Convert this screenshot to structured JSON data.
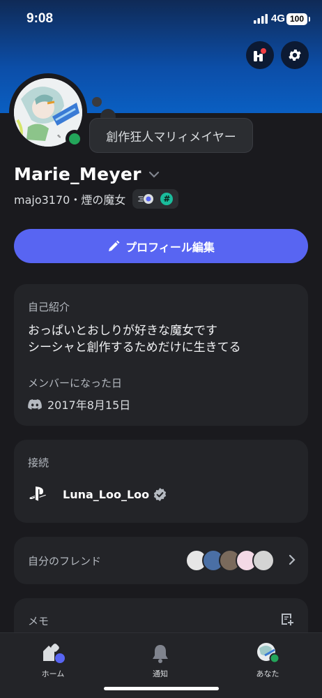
{
  "status_bar": {
    "time": "9:08",
    "network": "4G",
    "battery": "100"
  },
  "profile": {
    "custom_status": "創作狂人マリィメイヤー",
    "display_name": "Marie_Meyer",
    "handle": "majo3170",
    "separator": "・",
    "pronouns": "煙の魔女",
    "badge_hash": "#"
  },
  "edit_button": {
    "label": "プロフィール編集"
  },
  "about": {
    "title": "自己紹介",
    "lines": [
      "おっぱいとおしりが好きな魔女です",
      "シーシャと創作するためだけに生きてる"
    ],
    "member_since_title": "メンバーになった日",
    "member_since": "2017年8月15日"
  },
  "connections": {
    "title": "接続",
    "items": [
      {
        "service": "playstation-icon",
        "name": "Luna_Loo_Loo",
        "verified": true
      }
    ]
  },
  "friends": {
    "title": "自分のフレンド",
    "count_avatars": 5
  },
  "memo": {
    "title": "メモ"
  },
  "tabbar": {
    "home": "ホーム",
    "notifications": "通知",
    "you": "あなた"
  },
  "colors": {
    "accent": "#5865f2",
    "online": "#23a55a",
    "background": "#1a1a1e",
    "card": "#232428"
  }
}
